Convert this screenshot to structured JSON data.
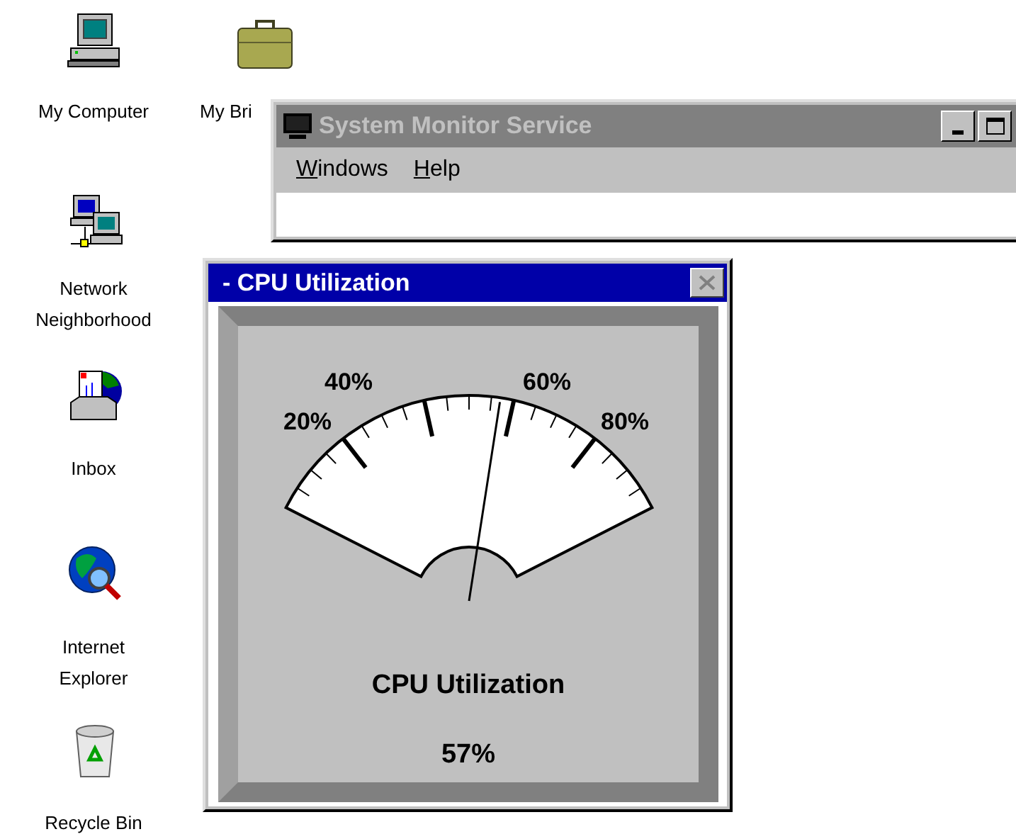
{
  "desktop_icons": [
    {
      "kind": "computer",
      "label": "My Computer"
    },
    {
      "kind": "briefcase",
      "label": "My Bri"
    },
    {
      "kind": "network",
      "label": "Network Neighborhood"
    },
    {
      "kind": "inbox",
      "label": "Inbox"
    },
    {
      "kind": "internet",
      "label": "Internet Explorer"
    },
    {
      "kind": "recycle-bin",
      "label": "Recycle Bin"
    }
  ],
  "main_window": {
    "title": "System Monitor Service",
    "active": false,
    "menu": [
      "Windows",
      "Help"
    ]
  },
  "cpu_window": {
    "title": "- CPU Utilization",
    "active": true,
    "gauge": {
      "labels": [
        "20%",
        "40%",
        "60%",
        "80%"
      ],
      "level": 0.57,
      "caption": "CPU Utilization",
      "reading": "57%"
    }
  }
}
